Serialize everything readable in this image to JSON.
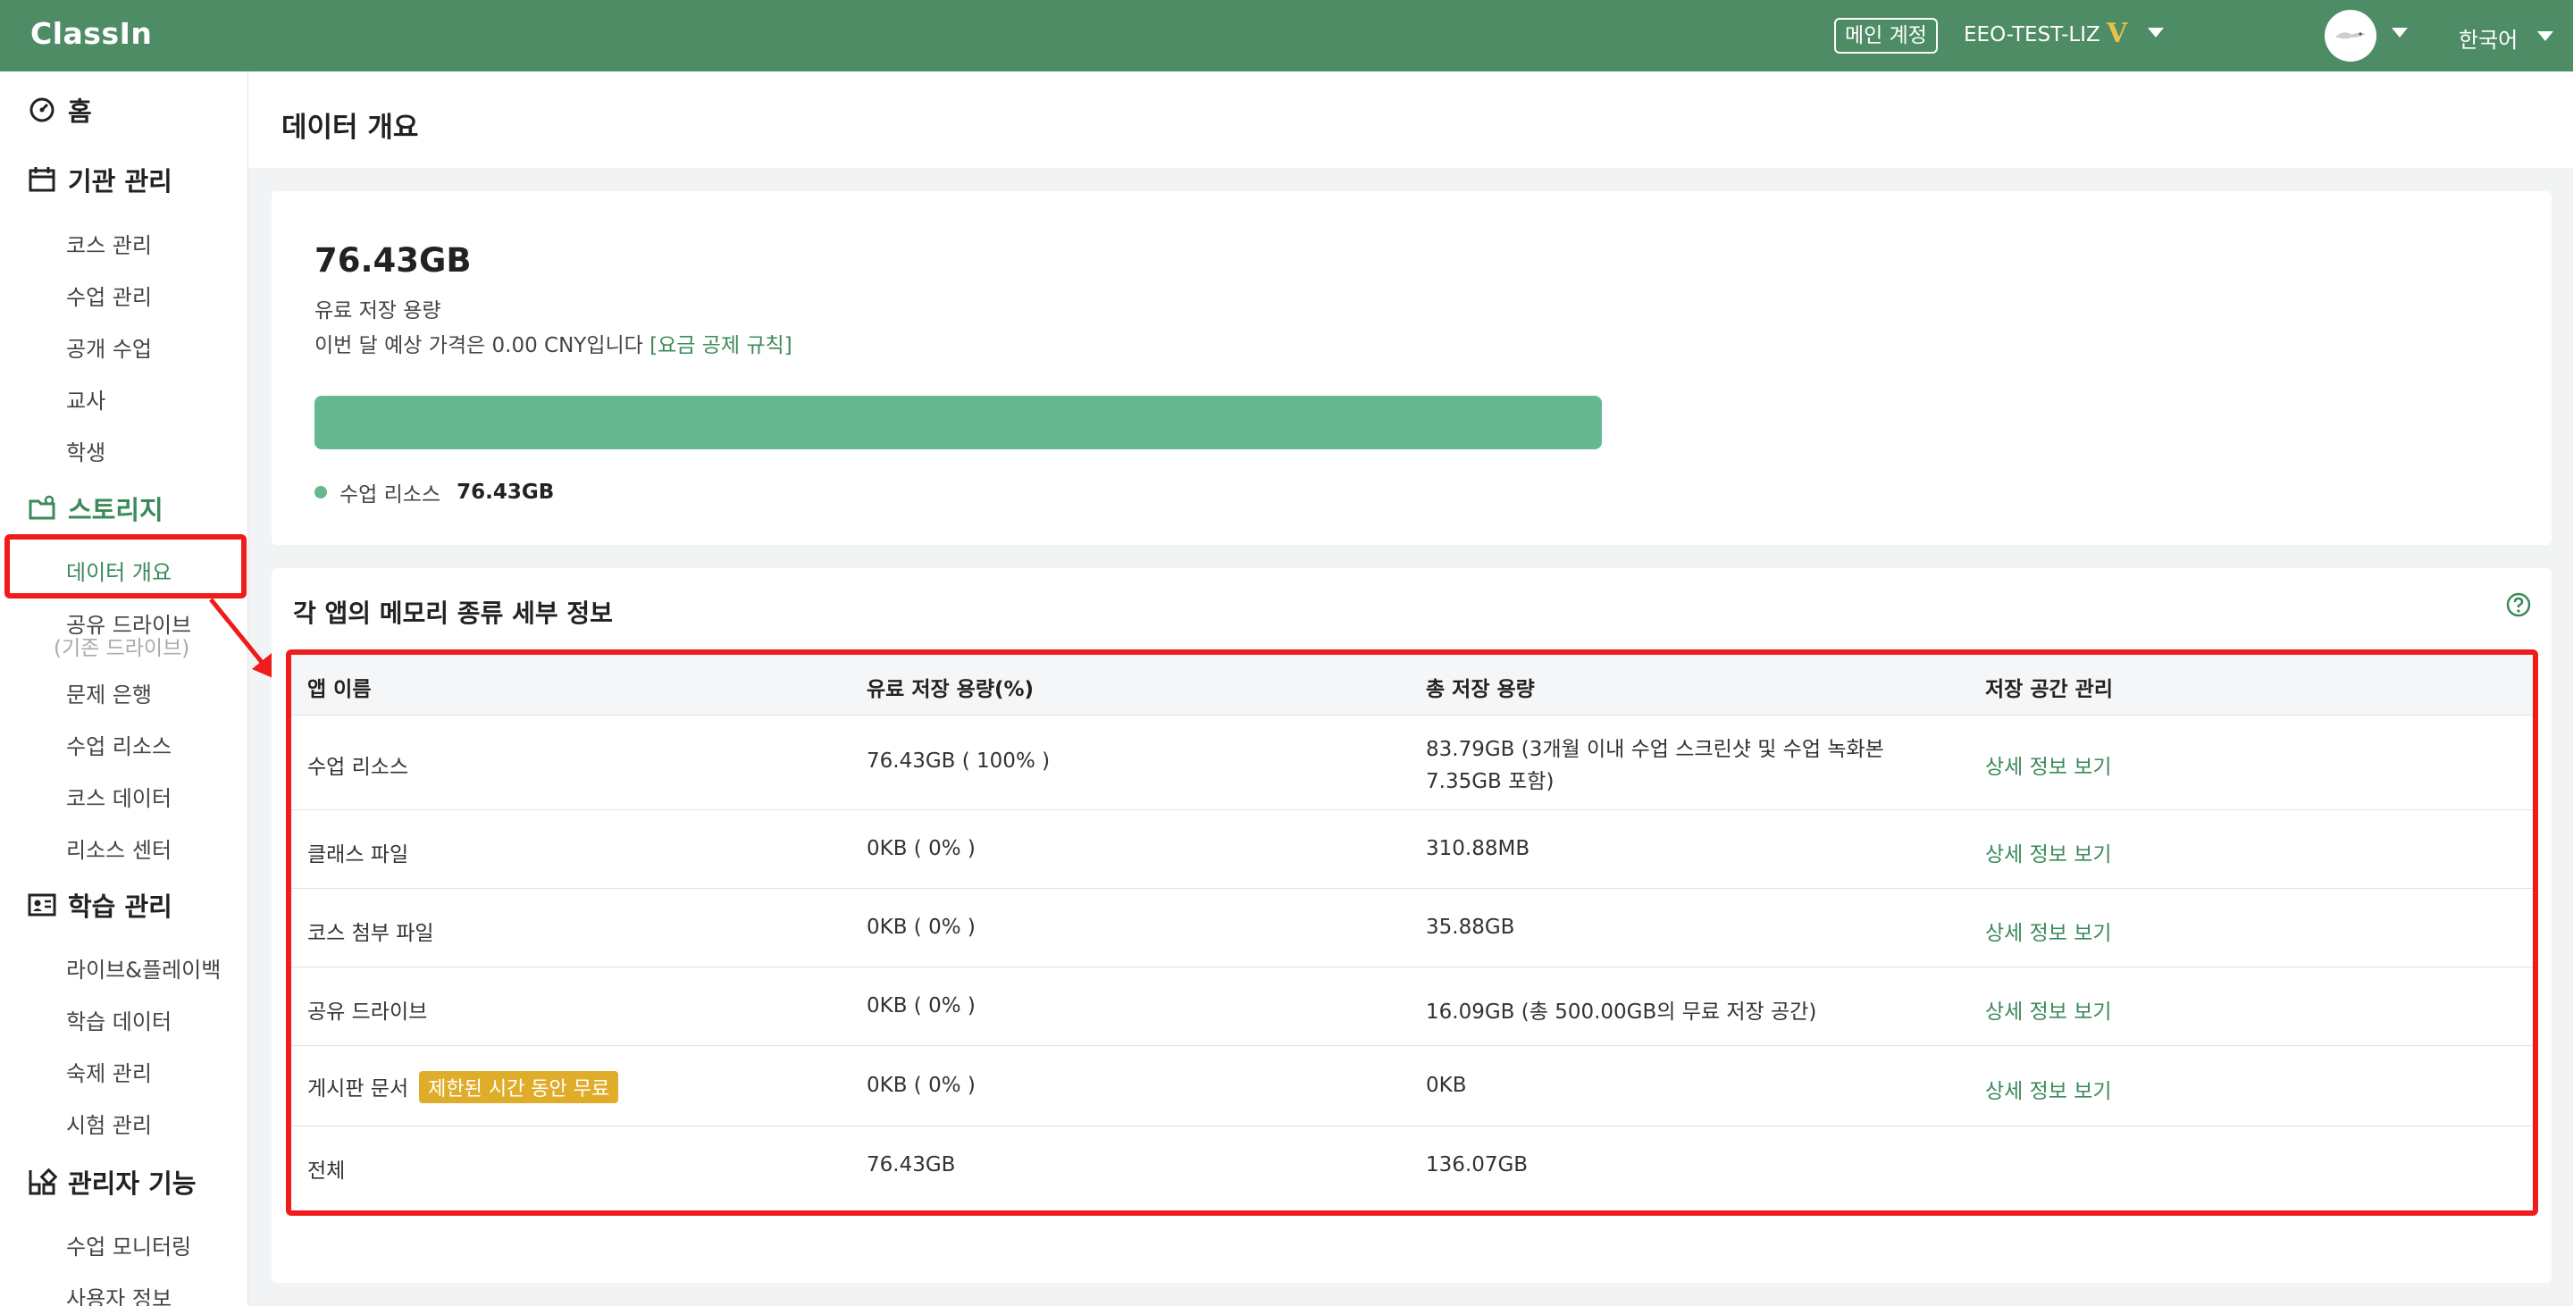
{
  "header": {
    "logo": "ClassIn",
    "account_badge": "메인 계정",
    "account_name": "EEO-TEST-LIZ",
    "vip_mark": "V",
    "language": "한국어"
  },
  "sidebar": {
    "home": "홈",
    "org_group": "기관 관리",
    "org_items": [
      "코스 관리",
      "수업 관리",
      "공개 수업",
      "교사",
      "학생"
    ],
    "storage_group": "스토리지",
    "storage_items": [
      "데이터 개요",
      "공유 드라이브",
      "문제 은행",
      "수업 리소스",
      "코스 데이터",
      "리소스 센터"
    ],
    "shared_drive_sub": "(기존 드라이브)",
    "learning_group": "학습 관리",
    "learning_items": [
      "라이브&플레이백",
      "학습 데이터",
      "숙제 관리",
      "시험 관리"
    ],
    "admin_group": "관리자 기능",
    "admin_items": [
      "수업 모니터링",
      "사용자 정보"
    ]
  },
  "main": {
    "page_title": "데이터 개요",
    "summary": {
      "total": "76.43GB",
      "paid_label": "유료 저장 용량",
      "price_text": "이번 달 예상 가격은 0.00 CNY입니다",
      "price_link": "[요금 공제 규칙]",
      "usage_fraction": 1.0,
      "legend_label": "수업 리소스",
      "legend_value": "76.43GB"
    },
    "section_title": "각 앱의 메모리 종류 세부 정보",
    "table": {
      "columns": [
        "앱 이름",
        "유료 저장 용량(%)",
        "총 저장 용량",
        "저장 공간 관리"
      ],
      "rows": [
        {
          "name": "수업 리소스",
          "paid": "76.43GB ( 100% )",
          "total_l1": "83.79GB (3개월 이내 수업 스크린샷 및 수업 녹화본",
          "total_l2": "7.35GB 포함)",
          "action": "상세 정보 보기"
        },
        {
          "name": "클래스 파일",
          "paid": "0KB ( 0% )",
          "total": "310.88MB",
          "action": "상세 정보 보기"
        },
        {
          "name": "코스 첨부 파일",
          "paid": "0KB ( 0% )",
          "total": "35.88GB",
          "action": "상세 정보 보기"
        },
        {
          "name": "공유 드라이브",
          "paid": "0KB ( 0% )",
          "total": "16.09GB (총 500.00GB의 무료 저장 공간)",
          "action": "상세 정보 보기"
        },
        {
          "name": "게시판 문서",
          "badge": "제한된 시간 동안 무료",
          "paid": "0KB ( 0% )",
          "total": "0KB",
          "action": "상세 정보 보기"
        },
        {
          "name": "전체",
          "paid": "76.43GB",
          "total": "136.07GB",
          "action": ""
        }
      ]
    }
  },
  "colors": {
    "header_bg": "#4e8c66",
    "accent_green": "#3b8a5a",
    "bar_green": "#65b890",
    "badge_gold": "#e0ad2b",
    "highlight_red": "#f01c1c"
  }
}
